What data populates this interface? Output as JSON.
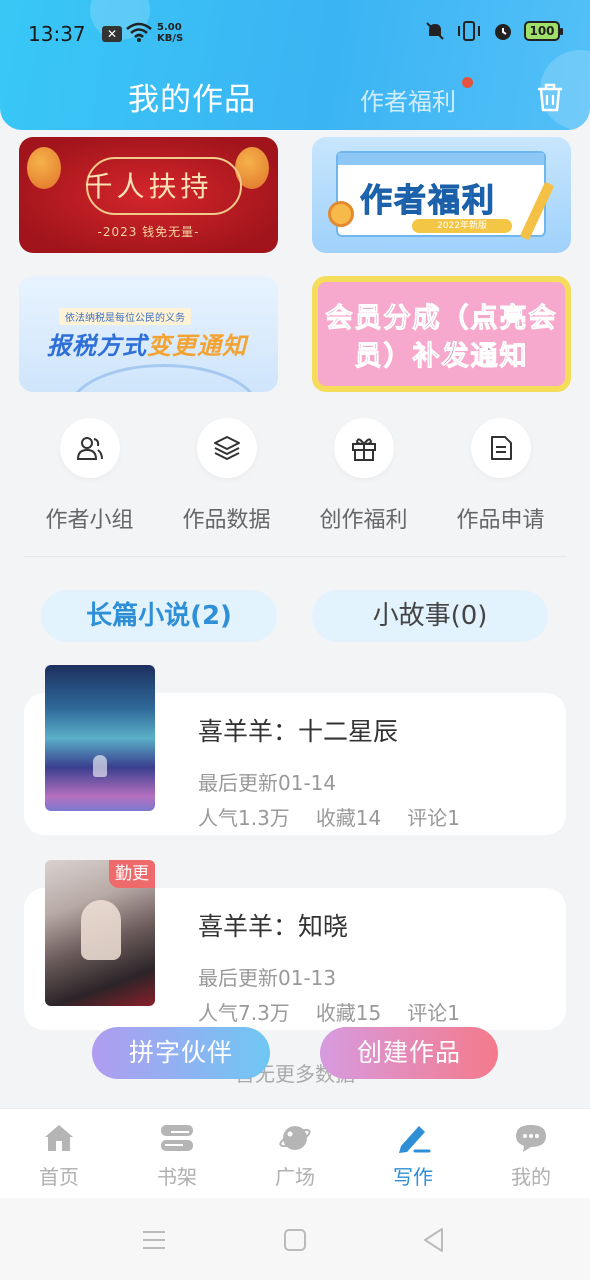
{
  "status_bar": {
    "time": "13:37",
    "net_speed_value": "5.00",
    "net_speed_unit": "KB/S",
    "battery": "100"
  },
  "header": {
    "title": "我的作品",
    "welfare_tab": "作者福利"
  },
  "banners": [
    {
      "title": "千人扶持",
      "subtitle": "-2023 钱免无量-"
    },
    {
      "title": "作者福利",
      "tag": "2022年新版"
    },
    {
      "small": "依法纳税是每位公民的义务",
      "title_a": "报税方式",
      "title_b": "变更通知"
    },
    {
      "title": "会员分成（点亮会员）补发通知"
    }
  ],
  "quick_actions": [
    {
      "label": "作者小组",
      "icon": "group-icon"
    },
    {
      "label": "作品数据",
      "icon": "layers-icon"
    },
    {
      "label": "创作福利",
      "icon": "gift-icon"
    },
    {
      "label": "作品申请",
      "icon": "document-icon"
    }
  ],
  "tabs": {
    "novel": "长篇小说(2)",
    "story": "小故事(0)"
  },
  "novels": [
    {
      "title": "喜羊羊：十二星辰",
      "updated": "最后更新01-14",
      "popularity": "人气1.3万",
      "favorites": "收藏14",
      "comments": "评论1",
      "badge": ""
    },
    {
      "title": "喜羊羊：知晓",
      "updated": "最后更新01-13",
      "popularity": "人气7.3万",
      "favorites": "收藏15",
      "comments": "评论1",
      "badge": "勤更"
    }
  ],
  "footer_text": "暂无更多数据",
  "fab": {
    "partner": "拼字伙伴",
    "create": "创建作品"
  },
  "bottom_nav": [
    {
      "label": "首页",
      "icon": "home-icon"
    },
    {
      "label": "书架",
      "icon": "bookshelf-icon"
    },
    {
      "label": "广场",
      "icon": "planet-icon"
    },
    {
      "label": "写作",
      "icon": "pen-icon"
    },
    {
      "label": "我的",
      "icon": "chat-bubble-icon"
    }
  ],
  "colors": {
    "accent": "#2f8fd6",
    "header": "#3bb4f3",
    "badge": "#ef6b6b"
  }
}
